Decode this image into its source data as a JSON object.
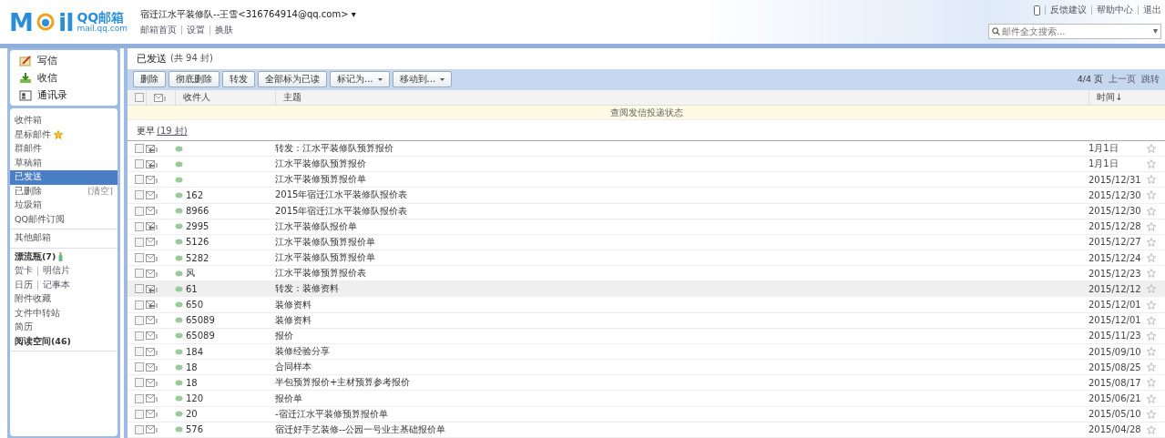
{
  "logo": {
    "left": "M",
    "right": "il",
    "product": "QQ邮箱",
    "domain": "mail.qq.com"
  },
  "account": {
    "name": "宿迁江水平装修队--王雪<316764914@qq.com>",
    "caret": "▾",
    "links": [
      "邮箱首页",
      "设置",
      "换肤"
    ]
  },
  "top_links": [
    "反馈建议",
    "帮助中心",
    "退出"
  ],
  "search": {
    "placeholder": "邮件全文搜索...",
    "caret": "▾"
  },
  "quick_actions": [
    {
      "label": "写信",
      "kind": "write"
    },
    {
      "label": "收信",
      "kind": "receive"
    },
    {
      "label": "通讯录",
      "kind": "contacts"
    }
  ],
  "folder_groups": [
    [
      {
        "label": "收件箱",
        "selected": false
      },
      {
        "label": "星标邮件",
        "selected": false,
        "star": true
      },
      {
        "label": "群邮件",
        "selected": false
      },
      {
        "label": "草稿箱",
        "selected": false
      },
      {
        "label": "已发送",
        "selected": true
      },
      {
        "label": "已删除",
        "selected": false,
        "action": "[清空]"
      },
      {
        "label": "垃圾箱",
        "selected": false
      },
      {
        "label": "QQ邮件订阅",
        "selected": false
      }
    ],
    [
      {
        "label": "其他邮箱",
        "selected": false
      }
    ],
    [
      {
        "label": "漂流瓶(7)",
        "selected": false,
        "bold": true,
        "bottle": true
      },
      {
        "links": [
          "贺卡",
          "明信片"
        ]
      },
      {
        "links": [
          "日历",
          "记事本"
        ]
      },
      {
        "label": "附件收藏",
        "selected": false
      },
      {
        "label": "文件中转站",
        "selected": false
      },
      {
        "label": "简历",
        "selected": false
      },
      {
        "label": "阅读空间(46)",
        "selected": false,
        "bold": true
      }
    ]
  ],
  "folder_title": "已发送",
  "folder_count": "(共 94 封)",
  "toolbar": [
    {
      "label": "删除",
      "menu": false
    },
    {
      "label": "彻底删除",
      "menu": false
    },
    {
      "label": "转发",
      "menu": false
    },
    {
      "label": "全部标为已读",
      "menu": false
    },
    {
      "label": "标记为...",
      "menu": true
    },
    {
      "label": "移动到...",
      "menu": true
    }
  ],
  "pager": {
    "page": "4/4 页",
    "prev": "上一页",
    "jump": "跳转"
  },
  "select_all": {
    "checked": false
  },
  "columns": [
    "收件人",
    "主题",
    "时间↓"
  ],
  "notice": "查阅发信投递状态",
  "group": {
    "label": "更早",
    "count": "(19 封)"
  },
  "rows": [
    {
      "recipient": "",
      "subject": "转发：江水平装修队预算报价",
      "date": "1月1日",
      "forwarded": true,
      "highlighted": false
    },
    {
      "recipient": "",
      "subject": "江水平装修队预算报价",
      "date": "1月1日",
      "forwarded": true,
      "highlighted": false
    },
    {
      "recipient": "",
      "subject": "江水平装修预算报价单",
      "date": "2015/12/31",
      "forwarded": false,
      "highlighted": false
    },
    {
      "recipient": "162",
      "subject": "2015年宿迁江水平装修队报价表",
      "date": "2015/12/30",
      "forwarded": false,
      "highlighted": false
    },
    {
      "recipient": "8966",
      "subject": "2015年宿迁江水平装修队报价表",
      "date": "2015/12/30",
      "forwarded": false,
      "highlighted": false
    },
    {
      "recipient": "2995",
      "subject": "江水平装修队报价单",
      "date": "2015/12/28",
      "forwarded": true,
      "highlighted": false
    },
    {
      "recipient": "5126",
      "subject": "江水平装修队预算报价单",
      "date": "2015/12/27",
      "forwarded": false,
      "highlighted": false
    },
    {
      "recipient": "5282",
      "subject": "江水平装修队预算报价单",
      "date": "2015/12/24",
      "forwarded": false,
      "highlighted": false
    },
    {
      "recipient": "风",
      "subject": "江水平装修预算报价表",
      "date": "2015/12/23",
      "forwarded": false,
      "highlighted": false
    },
    {
      "recipient": "61",
      "subject": "转发：装修资料",
      "date": "2015/12/12",
      "forwarded": true,
      "highlighted": true
    },
    {
      "recipient": "650",
      "subject": "装修资料",
      "date": "2015/12/01",
      "forwarded": true,
      "highlighted": false
    },
    {
      "recipient": "65089",
      "subject": "装修资料",
      "date": "2015/12/01",
      "forwarded": false,
      "highlighted": false
    },
    {
      "recipient": "65089",
      "subject": "报价",
      "date": "2015/11/23",
      "forwarded": false,
      "highlighted": false
    },
    {
      "recipient": "184",
      "subject": "装修经验分享",
      "date": "2015/09/10",
      "forwarded": false,
      "highlighted": false
    },
    {
      "recipient": "18",
      "subject": "合同样本",
      "date": "2015/08/25",
      "forwarded": false,
      "highlighted": false
    },
    {
      "recipient": "18",
      "subject": "半包预算报价+主材预算参考报价",
      "date": "2015/08/17",
      "forwarded": false,
      "highlighted": false
    },
    {
      "recipient": "120",
      "subject": "报价单",
      "date": "2015/06/21",
      "forwarded": false,
      "highlighted": false
    },
    {
      "recipient": "20",
      "subject": "-宿迁江水平装修预算报价单",
      "date": "2015/05/10",
      "forwarded": false,
      "highlighted": false
    },
    {
      "recipient": "576",
      "subject": "宿迁好手艺装修--公园一号业主基础报价单",
      "date": "2015/04/28",
      "forwarded": false,
      "highlighted": false
    }
  ]
}
